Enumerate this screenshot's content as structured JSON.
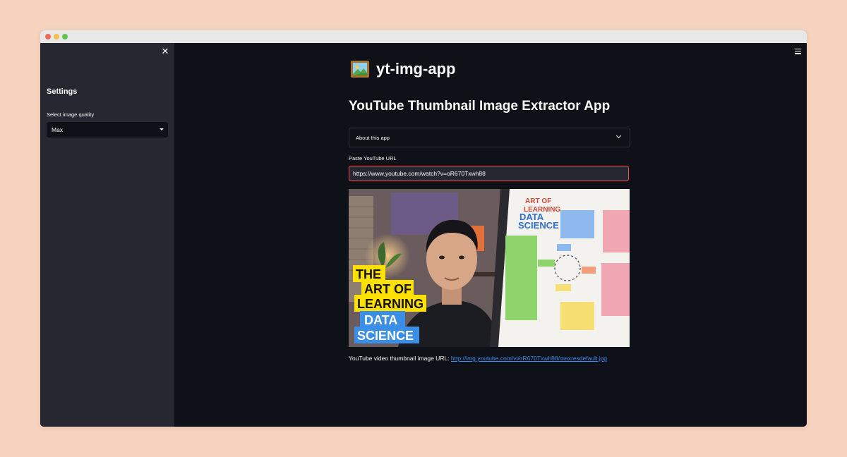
{
  "window": {
    "traffic_lights": [
      "close",
      "minimize",
      "maximize"
    ]
  },
  "sidebar": {
    "close_icon": "close-icon",
    "title": "Settings",
    "quality_label": "Select image quality",
    "quality_value": "Max"
  },
  "main": {
    "app_title": "yt-img-app",
    "app_icon": "framed-picture-icon",
    "heading": "YouTube Thumbnail Image Extractor App",
    "expander_label": "About this app",
    "url_label": "Paste YouTube URL",
    "url_value": "https://www.youtube.com/watch?v=oR670Txwh88",
    "thumbnail": {
      "text_lines": [
        "THE",
        "ART OF",
        "LEARNING",
        "DATA",
        "SCIENCE"
      ],
      "poster_title_lines": [
        "ART OF",
        "LEARNING",
        "DATA",
        "SCIENCE"
      ]
    },
    "result_prefix": "YouTube video thumbnail image URL:",
    "result_link": "http://img.youtube.com/vi/oR670Txwh88/maxresdefault.jpg"
  },
  "colors": {
    "background": "#0e1117",
    "sidebar": "#262730",
    "accent": "#ff4b4b",
    "link": "#3b8cf0",
    "page_bg": "#f5d3bf"
  }
}
